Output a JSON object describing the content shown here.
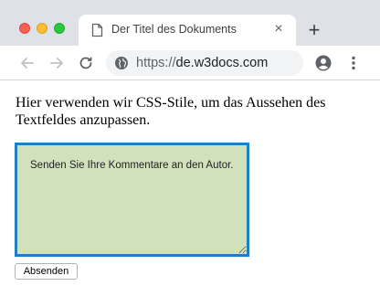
{
  "browser": {
    "window_controls": [
      "close",
      "minimize",
      "maximize"
    ],
    "tab": {
      "title": "Der Titel des Dokuments",
      "icon": "document-icon",
      "close_glyph": "×"
    },
    "new_tab_glyph": "+",
    "toolbar": {
      "back_icon": "arrow-left-icon",
      "forward_icon": "arrow-right-icon",
      "reload_icon": "reload-icon",
      "profile_icon": "account-circle-icon",
      "menu_icon": "more-vertical-icon"
    },
    "address_bar": {
      "scheme": "https://",
      "host": "de.w3docs.com",
      "icon": "globe-icon"
    }
  },
  "page": {
    "paragraph": "Hier verwenden wir CSS-Stile, um das Aussehen des Textfeldes anzupassen.",
    "textarea": {
      "value": "Senden Sie Ihre Kommentare an den Autor.",
      "background": "#d1e1bb",
      "border_color": "#1f7fc1"
    },
    "submit_label": "Absenden"
  }
}
